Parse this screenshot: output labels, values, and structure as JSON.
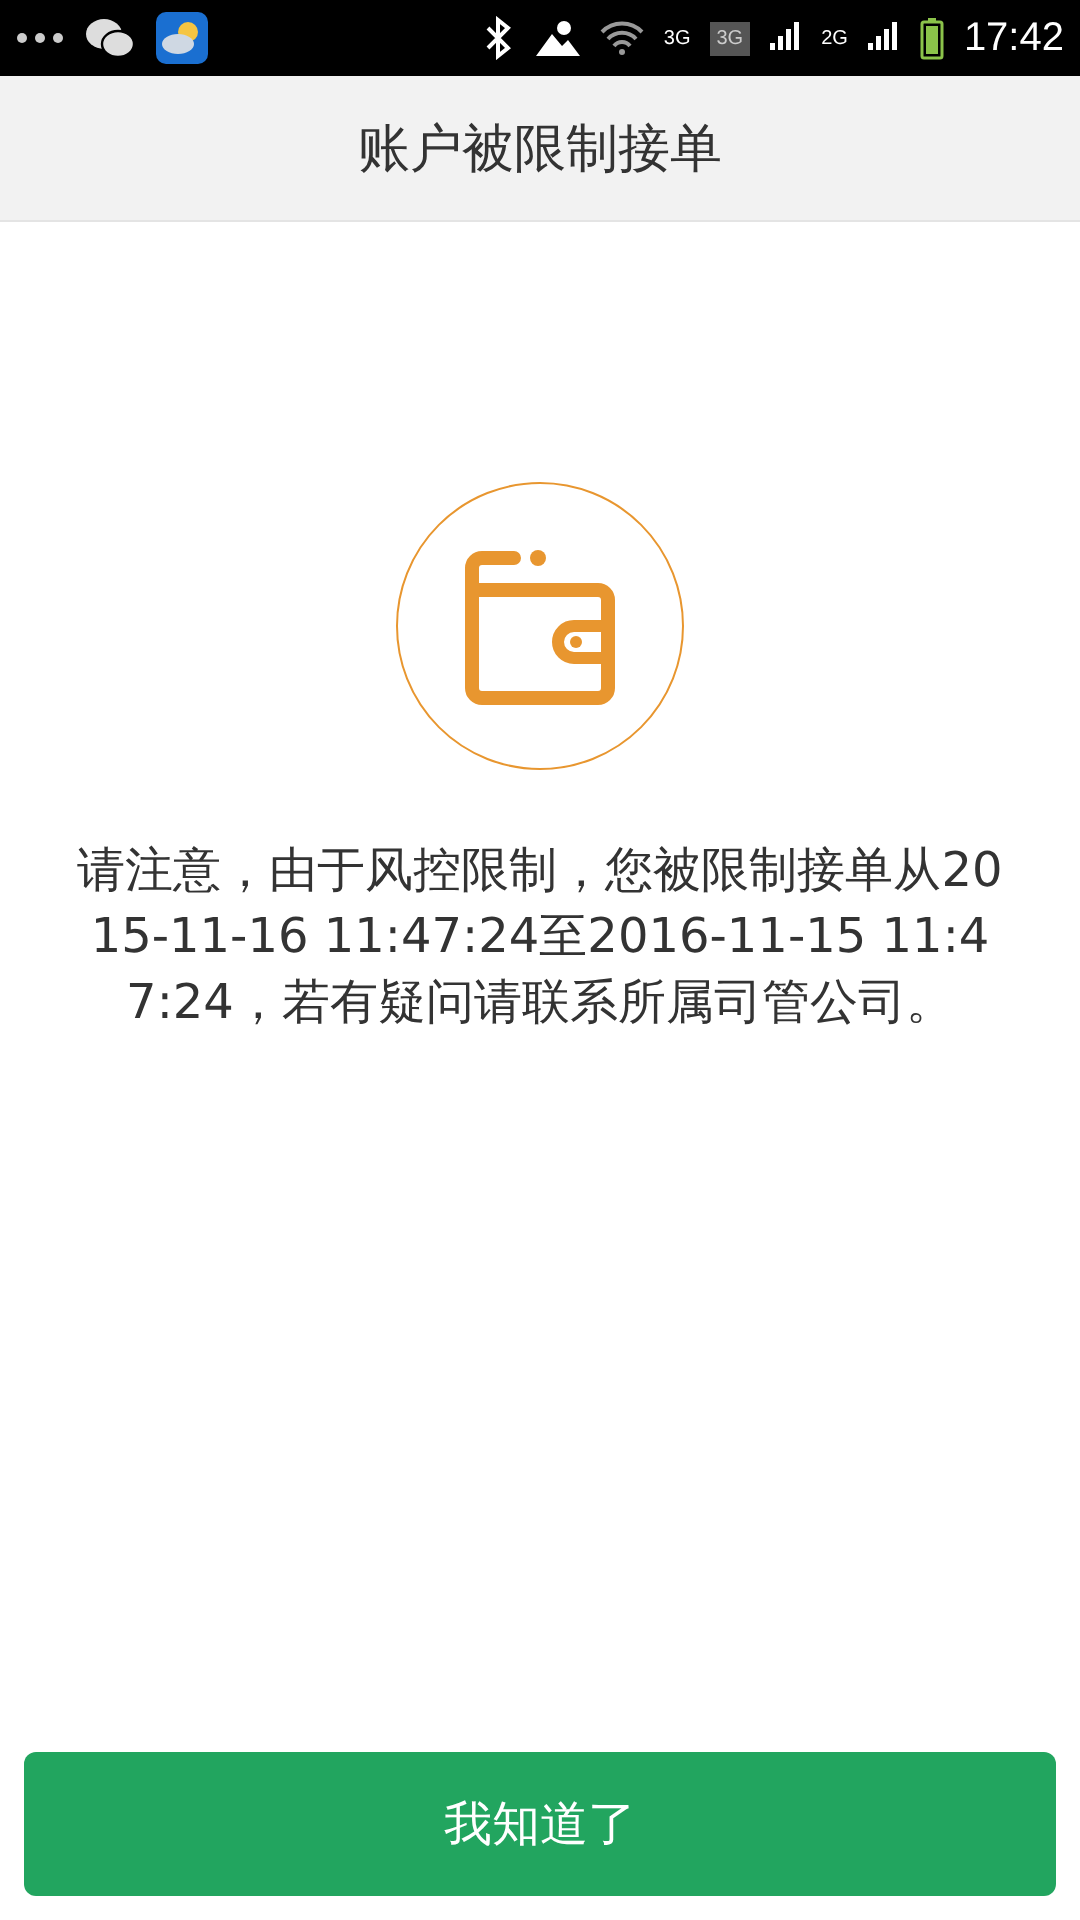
{
  "status_bar": {
    "network_labels": [
      "3G",
      "3G",
      "2G"
    ],
    "time": "17:42"
  },
  "header": {
    "title": "账户被限制接单"
  },
  "notice": {
    "message": "请注意，由于风控限制，您被限制接单从2015-11-16 11:47:24至2016-11-15 11:47:24，若有疑问请联系所属司管公司。"
  },
  "buttons": [
    {
      "label": "我知道了"
    }
  ]
}
